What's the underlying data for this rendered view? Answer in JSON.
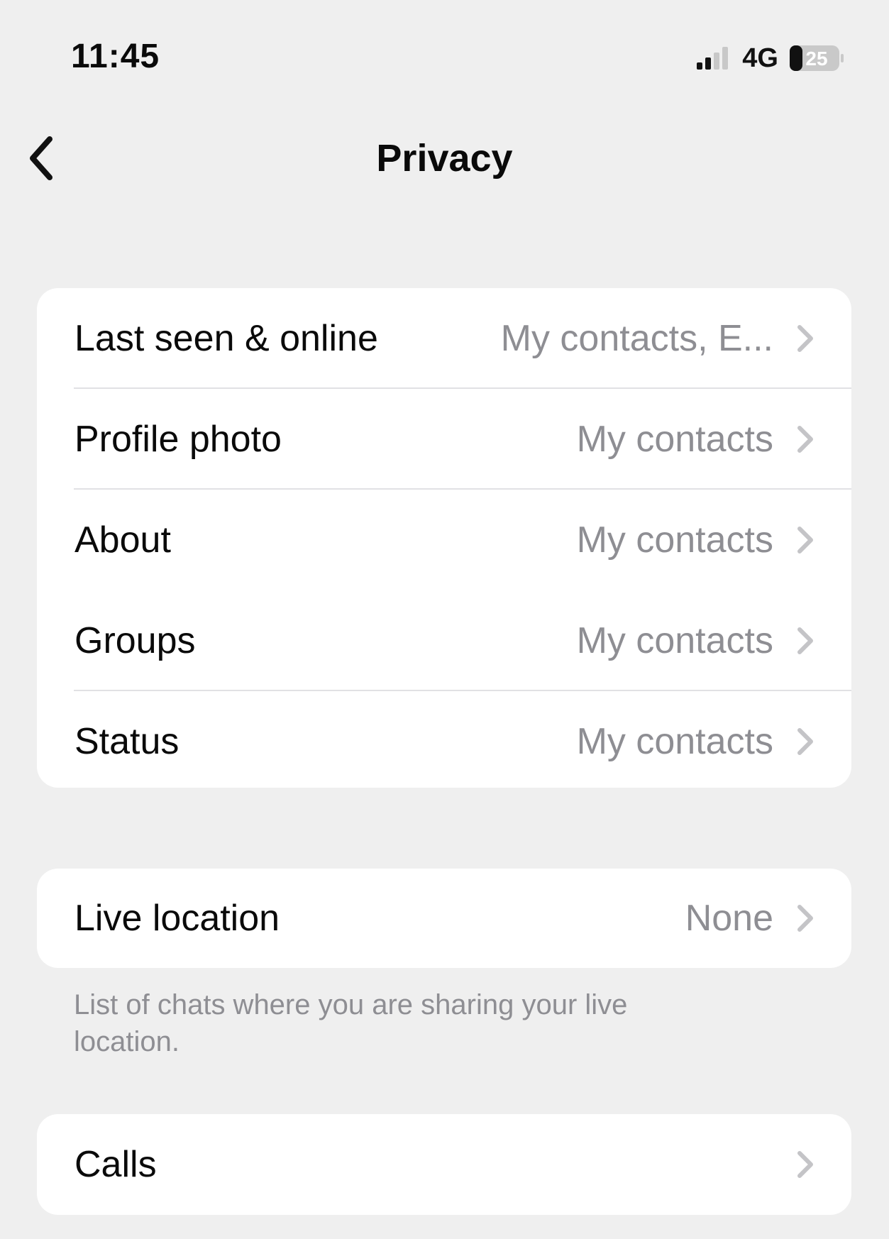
{
  "status_bar": {
    "time": "11:45",
    "network": "4G",
    "battery": "25",
    "signal_icon": "cellular-signal-icon",
    "battery_icon": "battery-icon"
  },
  "nav": {
    "title": "Privacy",
    "back_icon": "chevron-left-icon"
  },
  "sections": {
    "visibility": [
      {
        "label": "Last seen & online",
        "value": "My contacts, E..."
      },
      {
        "label": "Profile photo",
        "value": "My contacts"
      },
      {
        "label": "About",
        "value": "My contacts"
      },
      {
        "label": "Groups",
        "value": "My contacts"
      },
      {
        "label": "Status",
        "value": "My contacts"
      }
    ],
    "live_location": {
      "label": "Live location",
      "value": "None",
      "footnote": "List of chats where you are sharing your live location."
    },
    "calls": {
      "label": "Calls",
      "value": ""
    }
  },
  "colors": {
    "background": "#efefef",
    "card": "#ffffff",
    "primary_text": "#0a0a0a",
    "secondary_text": "#8e8e93",
    "chevron": "#c4c4c7"
  }
}
